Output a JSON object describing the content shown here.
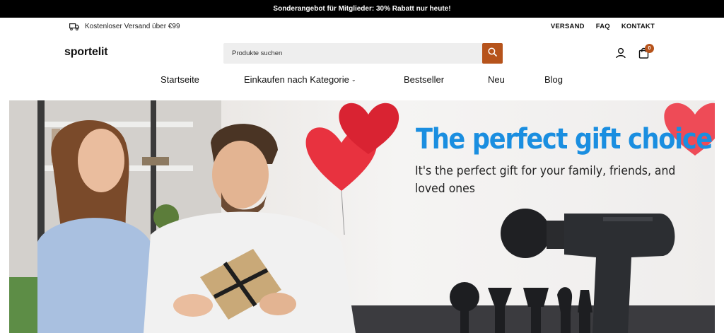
{
  "promo_bar": {
    "text": "Sonderangebot für Mitglieder: 30% Rabatt nur heute!"
  },
  "utility_bar": {
    "shipping_text": "Kostenloser Versand über €99",
    "links": [
      "VERSAND",
      "FAQ",
      "KONTAKT"
    ]
  },
  "header": {
    "logo": "sportelit",
    "search_placeholder": "Produkte suchen",
    "cart_count": "0"
  },
  "nav": {
    "items": [
      "Startseite",
      "Einkaufen nach Kategorie",
      "Bestseller",
      "Neu",
      "Blog"
    ]
  },
  "hero": {
    "title": "The perfect gift choice",
    "subtitle": "It's the perfect gift for your family, friends, and loved ones"
  },
  "colors": {
    "accent": "#b6531b",
    "hero_title": "#1a8ee0",
    "promo_bg": "#000000"
  },
  "icons": [
    "truck-icon",
    "search-icon",
    "user-icon",
    "bag-icon",
    "chevron-down-icon"
  ]
}
